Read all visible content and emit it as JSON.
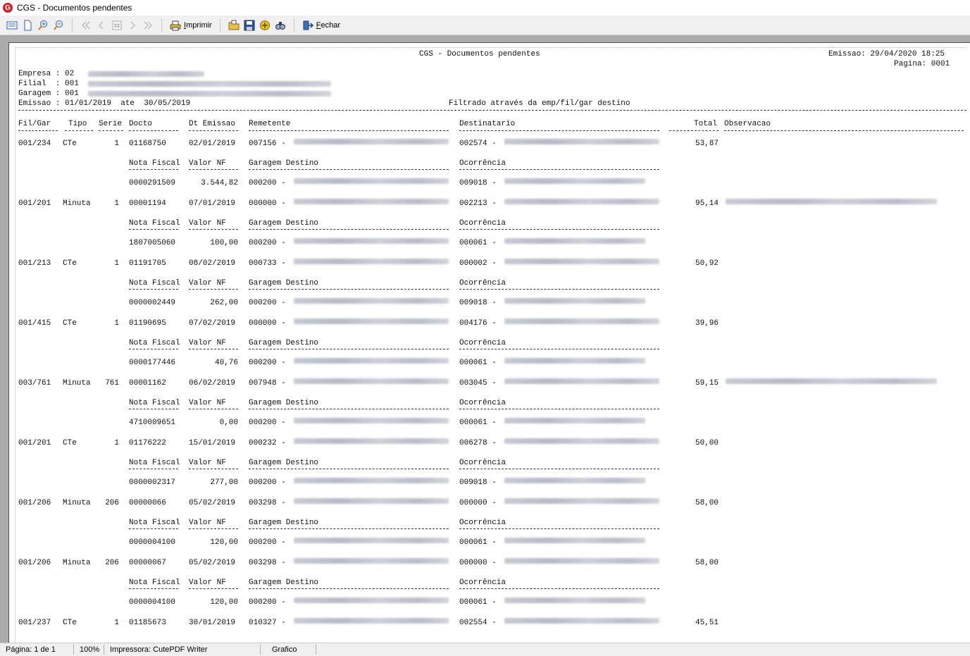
{
  "window": {
    "title": "CGS - Documentos pendentes",
    "logo_text": "G"
  },
  "toolbar": {
    "print_label": "Imprimir",
    "close_label": "Fechar"
  },
  "report": {
    "title": "CGS - Documentos pendentes",
    "emissao_header": "Emissao: 29/04/2020 18:25",
    "pagina_header": "Pagina: 0001",
    "empresa": "Empresa : 02",
    "filial": "Filial  : 001",
    "garagem": "Garagem : 001",
    "periodo": "Emissao : 01/01/2019  ate  30/05/2019",
    "filtro": "Filtrado através da emp/fil/gar destino",
    "columns": {
      "filgar": "Fil/Gar",
      "tipo": "Tipo",
      "serie": "Serie",
      "docto": "Docto",
      "dt": "Dt Emissao",
      "remetente": "Remetente",
      "destinatario": "Destinatario",
      "total": "Total",
      "obs": "Observacao"
    },
    "sub_columns": {
      "nf": "Nota Fiscal",
      "valor": "Valor NF",
      "garagem": "Garagem Destino",
      "ocorrencia": "Ocorrência"
    },
    "records": [
      {
        "filgar": "001/234",
        "tipo": "CTe",
        "serie": "1",
        "docto": "01168750",
        "dt": "02/01/2019",
        "rem": "007156 -",
        "dest": "002574 -",
        "total": "53,87",
        "nf": "0000291509",
        "valor": "3.544,82",
        "gar": "000200 -",
        "oco": "009018 -",
        "has_obs": false
      },
      {
        "filgar": "001/201",
        "tipo": "Minuta",
        "serie": "1",
        "docto": "00001194",
        "dt": "07/01/2019",
        "rem": "000000 -",
        "dest": "002213 -",
        "total": "95,14",
        "nf": "1807005060",
        "valor": "100,00",
        "gar": "000200 -",
        "oco": "000061 -",
        "has_obs": true
      },
      {
        "filgar": "001/213",
        "tipo": "CTe",
        "serie": "1",
        "docto": "01191705",
        "dt": "08/02/2019",
        "rem": "000733 -",
        "dest": "000002 -",
        "total": "50,92",
        "nf": "0000002449",
        "valor": "262,00",
        "gar": "000200 -",
        "oco": "009018 -",
        "has_obs": false
      },
      {
        "filgar": "001/415",
        "tipo": "CTe",
        "serie": "1",
        "docto": "01190695",
        "dt": "07/02/2019",
        "rem": "000000 -",
        "dest": "004176 -",
        "total": "39,96",
        "nf": "0000177446",
        "valor": "40,76",
        "gar": "000200 -",
        "oco": "000061 -",
        "has_obs": false
      },
      {
        "filgar": "003/761",
        "tipo": "Minuta",
        "serie": "761",
        "docto": "00001162",
        "dt": "06/02/2019",
        "rem": "007948 -",
        "dest": "003045 -",
        "total": "59,15",
        "nf": "4710009651",
        "valor": "0,00",
        "gar": "000200 -",
        "oco": "000061 -",
        "has_obs": true
      },
      {
        "filgar": "001/201",
        "tipo": "CTe",
        "serie": "1",
        "docto": "01176222",
        "dt": "15/01/2019",
        "rem": "000232 -",
        "dest": "006278 -",
        "total": "50,00",
        "nf": "0000002317",
        "valor": "277,00",
        "gar": "000200 -",
        "oco": "009018 -",
        "has_obs": false
      },
      {
        "filgar": "001/206",
        "tipo": "Minuta",
        "serie": "206",
        "docto": "00000066",
        "dt": "05/02/2019",
        "rem": "003298 -",
        "dest": "000000 -",
        "total": "58,00",
        "nf": "0000004100",
        "valor": "120,00",
        "gar": "000200 -",
        "oco": "000061 -",
        "has_obs": false
      },
      {
        "filgar": "001/206",
        "tipo": "Minuta",
        "serie": "206",
        "docto": "00000067",
        "dt": "05/02/2019",
        "rem": "003298 -",
        "dest": "000000 -",
        "total": "58,00",
        "nf": "0000004100",
        "valor": "120,00",
        "gar": "000200 -",
        "oco": "000061 -",
        "has_obs": false
      },
      {
        "filgar": "001/237",
        "tipo": "CTe",
        "serie": "1",
        "docto": "01185673",
        "dt": "30/01/2019",
        "rem": "010327 -",
        "dest": "002554 -",
        "total": "45,51",
        "has_obs": false,
        "partial": true
      }
    ]
  },
  "status": {
    "page": "Página: 1 de 1",
    "zoom": "100%",
    "printer": "Impressora: CutePDF Writer",
    "mode": "Grafico"
  }
}
